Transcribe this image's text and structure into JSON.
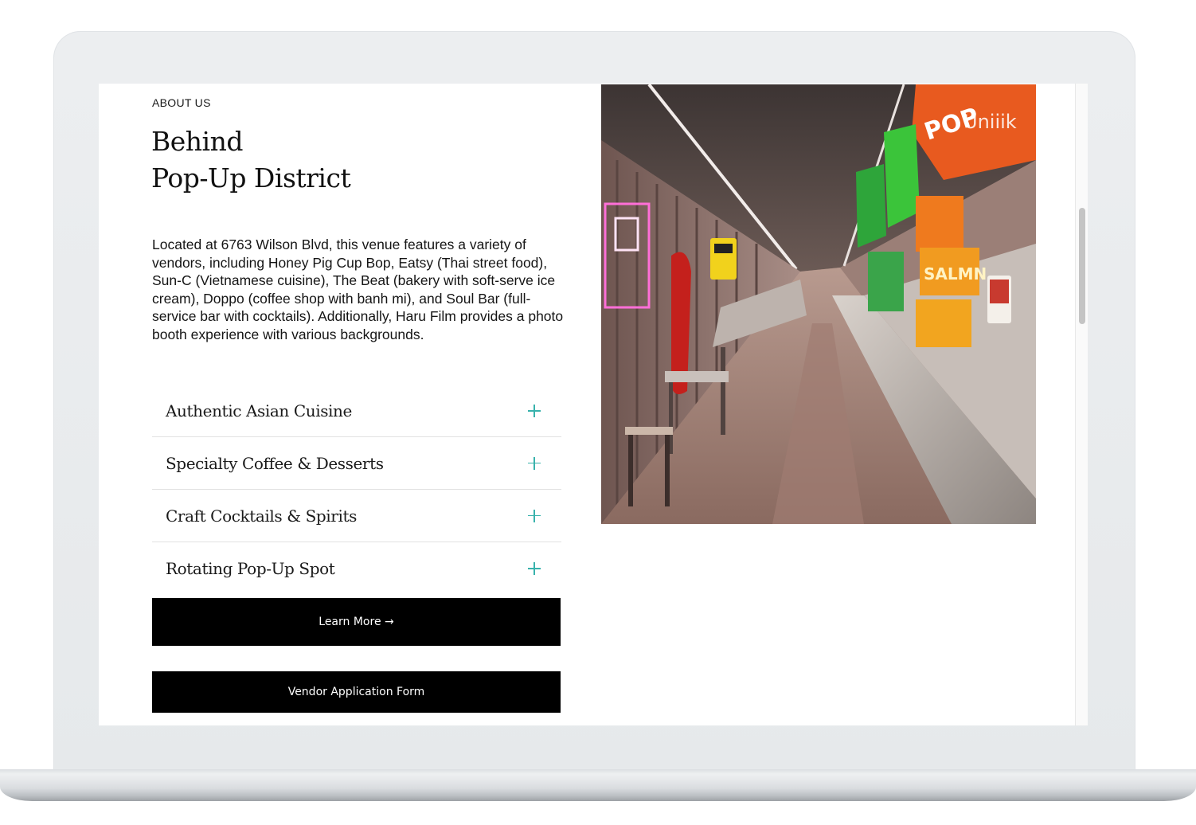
{
  "about": {
    "eyebrow": "ABOUT US",
    "title_line1": "Behind",
    "title_line2": "Pop-Up District",
    "description": "Located at 6763 Wilson Blvd, this venue features a variety of vendors, including Honey Pig Cup Bop, Eatsy (Thai street food), Sun-C (Vietnamese cuisine), The Beat (bakery with soft-serve ice cream), Doppo (coffee shop with banh mi), and Soul Bar (full-service bar with cocktails). Additionally, Haru Film provides a photo booth experience with various backgrounds."
  },
  "accordion": {
    "items": [
      {
        "label": "Authentic Asian Cuisine",
        "icon": "plus-icon"
      },
      {
        "label": "Specialty Coffee & Desserts",
        "icon": "plus-icon"
      },
      {
        "label": "Craft Cocktails & Spirits",
        "icon": "plus-icon"
      },
      {
        "label": "Rotating Pop-Up Spot",
        "icon": "plus-icon"
      }
    ],
    "accent_color": "#38b2ac"
  },
  "buttons": {
    "learn_more": "Learn More →",
    "vendor_form": "Vendor Application Form"
  },
  "photo": {
    "watermark": "Uniiik"
  },
  "colors": {
    "button_bg": "#000000",
    "button_text": "#ffffff",
    "device_frame": "#e8eaec"
  }
}
